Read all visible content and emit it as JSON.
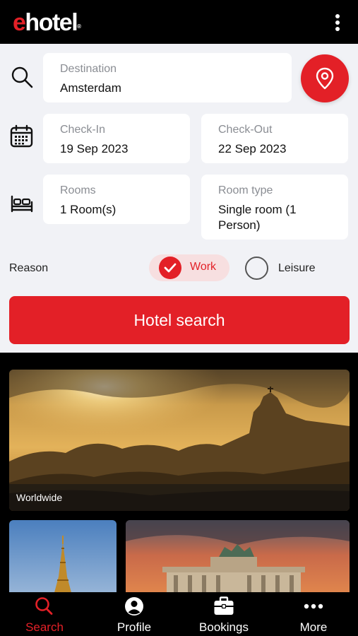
{
  "header": {
    "logo_e": "e",
    "logo_rest": "hotel",
    "logo_reg": "®",
    "menu_icon": "more-vertical-icon"
  },
  "form": {
    "destination": {
      "label": "Destination",
      "value": "Amsterdam"
    },
    "check_in": {
      "label": "Check-In",
      "value": "19 Sep 2023"
    },
    "check_out": {
      "label": "Check-Out",
      "value": "22 Sep 2023"
    },
    "rooms": {
      "label": "Rooms",
      "value": "1 Room(s)"
    },
    "room_type": {
      "label": "Room type",
      "value": "Single room (1 Person)"
    },
    "reason": {
      "label": "Reason",
      "options": [
        {
          "label": "Work",
          "selected": true
        },
        {
          "label": "Leisure",
          "selected": false
        }
      ]
    },
    "search_button": "Hotel search"
  },
  "destinations": {
    "featured": "Worldwide"
  },
  "tabbar": {
    "items": [
      {
        "label": "Search",
        "icon": "search-icon",
        "active": true
      },
      {
        "label": "Profile",
        "icon": "user-circle-icon",
        "active": false
      },
      {
        "label": "Bookings",
        "icon": "briefcase-icon",
        "active": false
      },
      {
        "label": "More",
        "icon": "more-horizontal-icon",
        "active": false
      }
    ]
  },
  "colors": {
    "brand_red": "#e32027",
    "panel_bg": "#f1f2f6",
    "work_pill_bg": "#f7dfe0"
  }
}
